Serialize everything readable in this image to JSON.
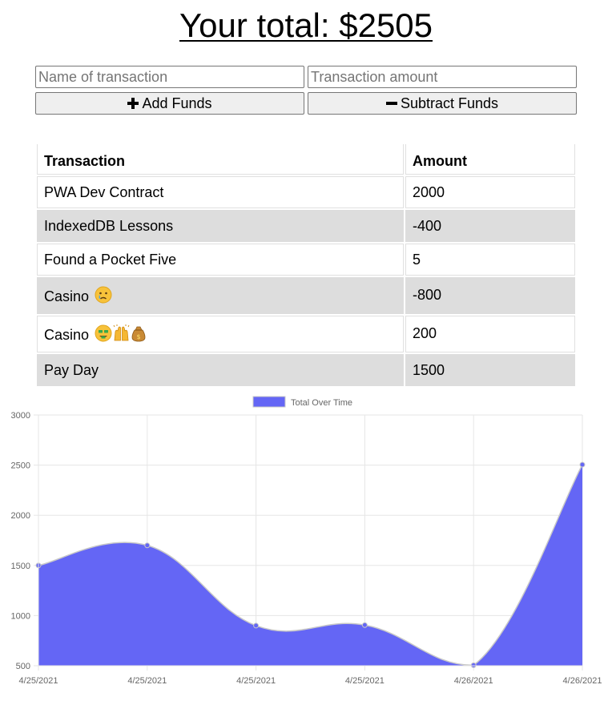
{
  "header": {
    "total_text": "Your total: $2505"
  },
  "form": {
    "name_placeholder": "Name of transaction",
    "amount_placeholder": "Transaction amount",
    "add_label": "Add Funds",
    "subtract_label": "Subtract Funds"
  },
  "table": {
    "headers": [
      "Transaction",
      "Amount"
    ],
    "rows": [
      {
        "name": "PWA Dev Contract",
        "amount": "2000"
      },
      {
        "name": "IndexedDB Lessons",
        "amount": "-400"
      },
      {
        "name": "Found a Pocket Five",
        "amount": "5"
      },
      {
        "name": "Casino",
        "amount": "-800",
        "emoji": [
          "crying-face"
        ]
      },
      {
        "name": "Casino",
        "amount": "200",
        "emoji": [
          "money-mouth-face",
          "raising-hands",
          "money-bag"
        ]
      },
      {
        "name": "Pay Day",
        "amount": "1500"
      }
    ]
  },
  "colors": {
    "fill": "#6466f5",
    "stroke": "#c8c8c8",
    "grid": "#e6e6e6",
    "row_alt": "#dddddd"
  },
  "chart_data": {
    "type": "area",
    "x": [
      "4/25/2021",
      "4/25/2021",
      "4/25/2021",
      "4/25/2021",
      "4/26/2021",
      "4/26/2021"
    ],
    "series": [
      {
        "name": "Total Over Time",
        "values": [
          1500,
          1700,
          900,
          905,
          505,
          2505
        ]
      }
    ],
    "yticks": [
      500,
      1000,
      1500,
      2000,
      2500,
      3000
    ],
    "ylim": [
      500,
      3000
    ],
    "grid": true,
    "legend_position": "top"
  }
}
